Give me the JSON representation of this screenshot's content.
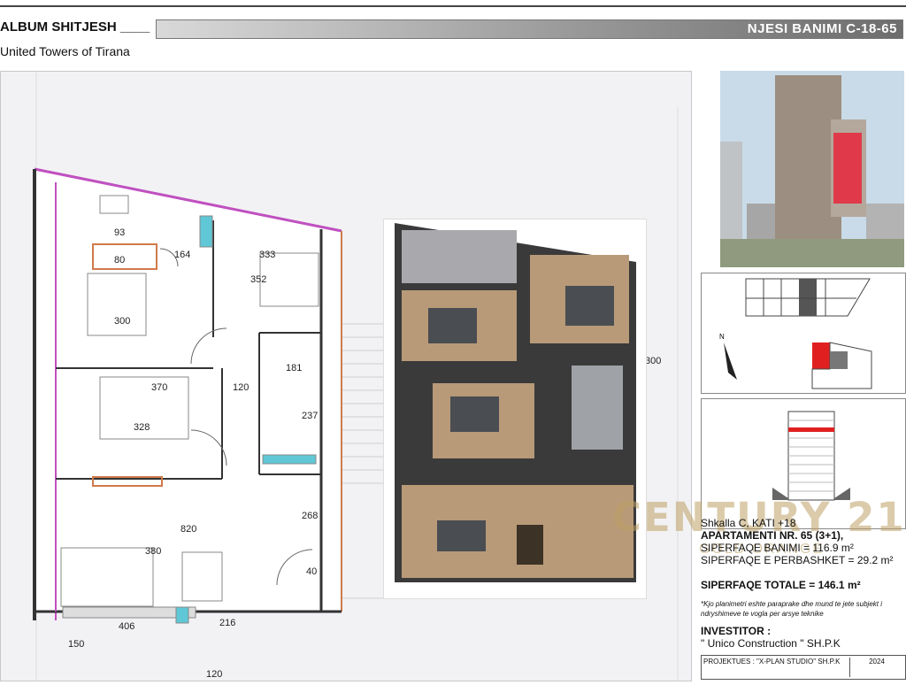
{
  "header": {
    "album": "ALBUM SHITJESH ____",
    "project": "United  Towers of Tirana",
    "unit_code": "NJESI BANIMI C-18-65"
  },
  "plan": {
    "dimensions": [
      "93",
      "80",
      "164",
      "333",
      "352",
      "300",
      "370",
      "120",
      "181",
      "328",
      "237",
      "268",
      "820",
      "380",
      "40",
      "216",
      "406",
      "150",
      "120",
      "300"
    ]
  },
  "info": {
    "line1": "Shkalla C, KATI +18",
    "line2": "APARTAMENTI NR. 65 (3+1),",
    "line3": "SIPERFAQE BANIMI = 116.9 m²",
    "line4": "SIPERFAQE E PERBASHKET = 29.2 m²",
    "total": "SIPERFAQE TOTALE = 146.1 m²",
    "note": "*Kjo planimetri eshte paraprake dhe mund te jete subjekt i ndryshimeve te vogla per arsye teknike",
    "investor_label": "INVESTITOR :",
    "investor": "\" Unico Construction \" SH.P.K",
    "designer": "PROJEKTUES : \"X-PLAN STUDIO\" SH.P.K",
    "year": "2024"
  },
  "watermark": {
    "brand": "CENTURY 21",
    "office": "GOLD ORANGE"
  },
  "colors": {
    "accent_frame": "#d07a4a",
    "wall": "#333333",
    "partition_pink": "#c050c0",
    "highlight_red": "#e02020"
  }
}
